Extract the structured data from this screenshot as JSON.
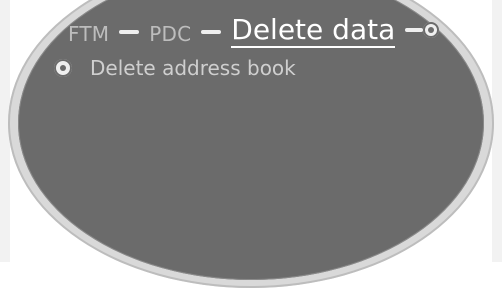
{
  "breadcrumb": {
    "items": [
      "FTM",
      "PDC"
    ],
    "current": "Delete data"
  },
  "menu": {
    "items": [
      {
        "label": "Delete address book",
        "icon": "radio-button-icon"
      }
    ]
  },
  "colors": {
    "display_bg": "#6b6b6b",
    "active_text": "#ffffff",
    "inactive_text": "#bdbdbd",
    "separator": "#efefef"
  }
}
